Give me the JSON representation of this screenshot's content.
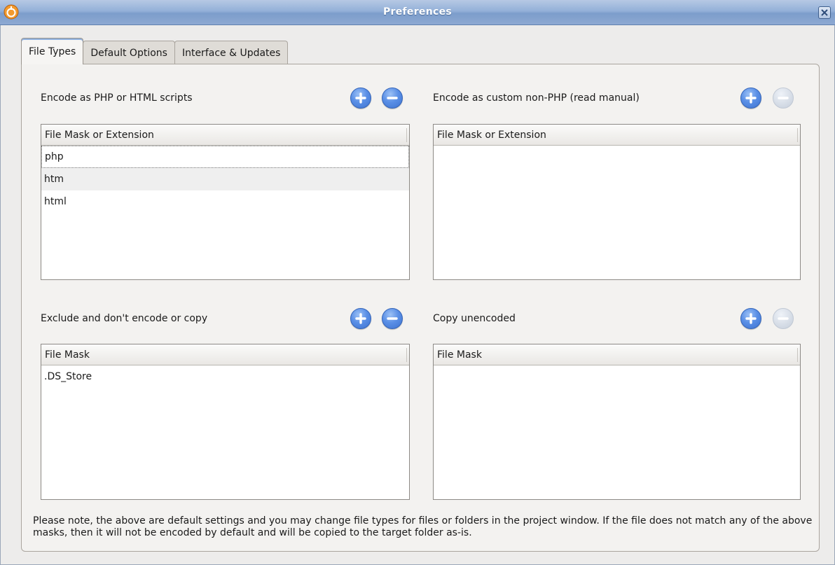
{
  "window": {
    "title": "Preferences"
  },
  "tabs": [
    {
      "label": "File Types",
      "active": true
    },
    {
      "label": "Default Options",
      "active": false
    },
    {
      "label": "Interface & Updates",
      "active": false
    }
  ],
  "sections": {
    "php_html": {
      "label": "Encode as PHP or HTML scripts",
      "column_header": "File Mask or Extension",
      "rows": [
        "php",
        "htm",
        "html"
      ],
      "remove_enabled": true
    },
    "custom": {
      "label": "Encode as custom non-PHP (read manual)",
      "column_header": "File Mask or Extension",
      "rows": [],
      "remove_enabled": false
    },
    "exclude": {
      "label": "Exclude and don't encode or copy",
      "column_header": "File Mask",
      "rows": [
        ".DS_Store"
      ],
      "remove_enabled": true
    },
    "copy": {
      "label": "Copy unencoded",
      "column_header": "File Mask",
      "rows": [],
      "remove_enabled": false
    }
  },
  "note": "Please note, the above are default settings and you may change file types for files or folders in the project window. If the file does not match any of the above masks, then it will not be encoded by default and will be copied to the target folder as-is.",
  "icons": {
    "add": "plus-circle-icon",
    "remove": "minus-circle-icon",
    "close": "close-icon",
    "app": "app-logo-icon"
  },
  "colors": {
    "titlebar": "#8ea9d2",
    "button_blue": "#5a8fe6",
    "button_disabled": "#d5dce6"
  }
}
